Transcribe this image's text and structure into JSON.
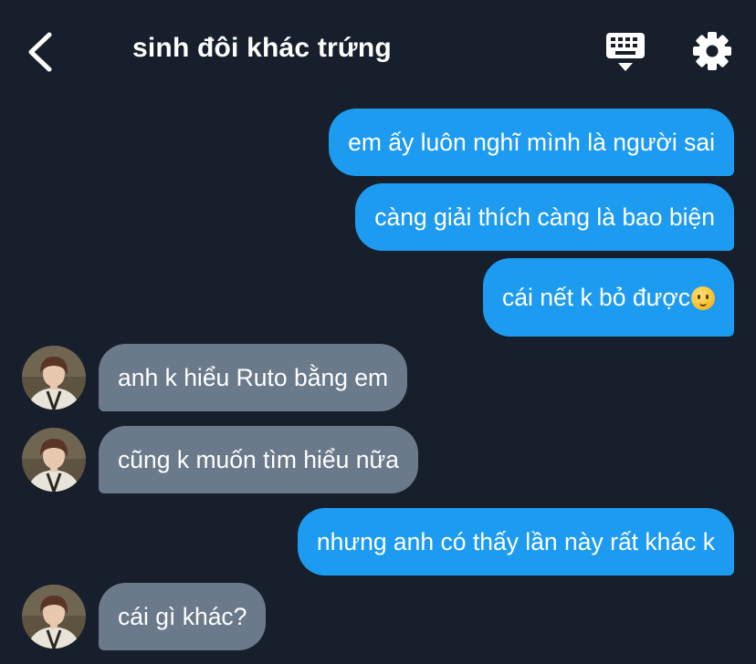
{
  "header": {
    "title": "sinh đôi khác trứng",
    "back_icon": "chevron-left-icon",
    "keyboard_icon": "keyboard-icon",
    "settings_icon": "gear-icon"
  },
  "messages": [
    {
      "side": "out",
      "text": "em ấy luôn nghĩ mình là người sai"
    },
    {
      "side": "out",
      "text": "càng giải thích càng là bao biện"
    },
    {
      "side": "out",
      "text": "cái nết k bỏ được",
      "emoji": "face-holding-back-tears-emoji"
    },
    {
      "side": "in",
      "text": "anh k hiểu Ruto bằng em"
    },
    {
      "side": "in",
      "text": "cũng k muốn tìm hiểu nữa"
    },
    {
      "side": "out",
      "text": "nhưng anh có thấy lần này rất khác k"
    },
    {
      "side": "in",
      "text": "cái gì khác?"
    }
  ],
  "colors": {
    "background": "#161f2b",
    "outgoing_bubble": "#1d9bf0",
    "incoming_bubble": "#6b7a8a"
  }
}
